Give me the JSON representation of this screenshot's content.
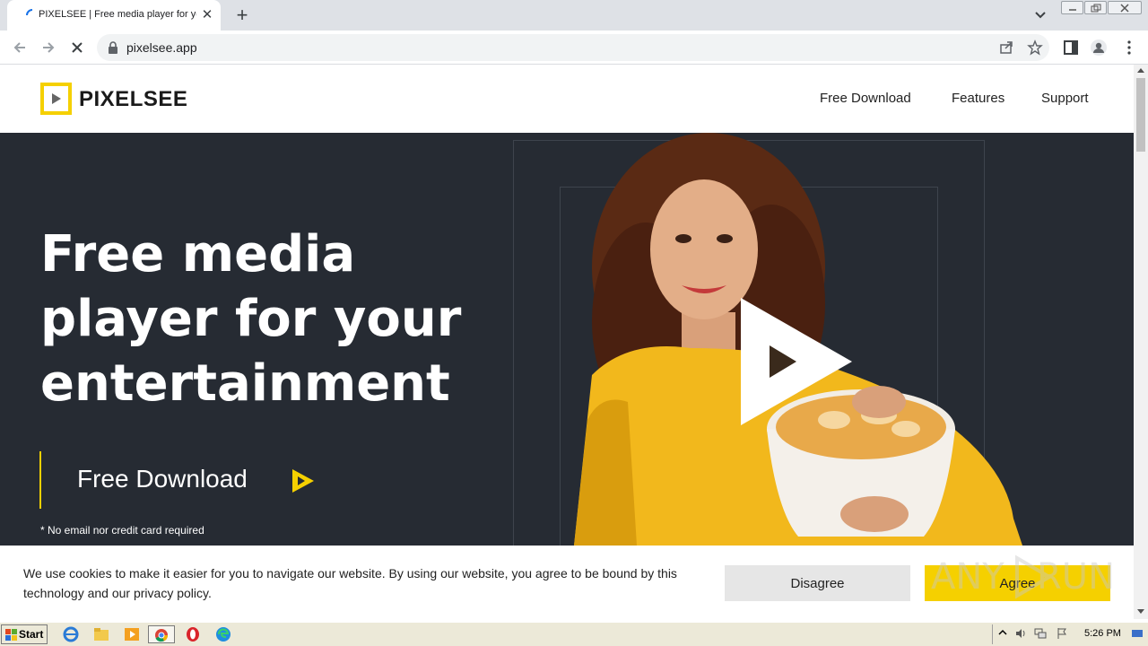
{
  "browser": {
    "tab_title": "PIXELSEE | Free media player for yo",
    "tab_close": "✕",
    "new_tab": "+",
    "url": "pixelsee.app"
  },
  "site": {
    "logo_text": "PIXELSEE",
    "nav": [
      "Free Download",
      "Features",
      "Support"
    ]
  },
  "hero": {
    "title_lines": [
      "Free media",
      "player for your",
      "entertainment"
    ],
    "download_label": "Free Download",
    "note": "* No email nor credit card required"
  },
  "cookie": {
    "text": "We use cookies to make it easier for you to navigate our website. By using our website, you agree to be bound by this technology and our privacy policy.",
    "disagree": "Disagree",
    "agree": "Agree"
  },
  "watermark": {
    "left": "ANY",
    "right": "RUN"
  },
  "taskbar": {
    "start": "Start",
    "clock": "5:26 PM"
  },
  "colors": {
    "accent": "#f5d000",
    "hero_bg": "#262b33",
    "disagree_bg": "#e6e6e6"
  }
}
